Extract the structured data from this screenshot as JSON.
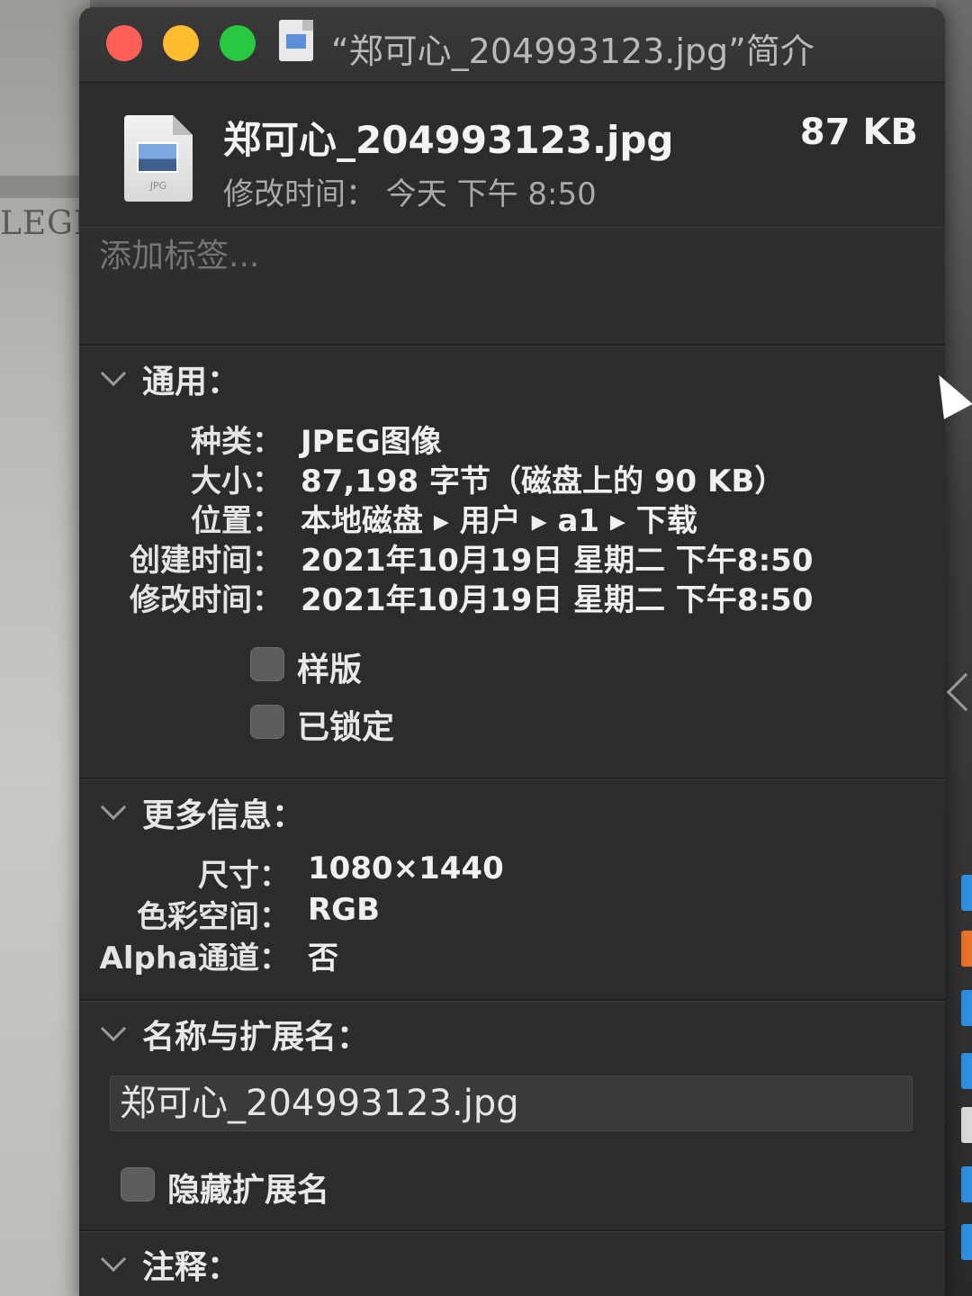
{
  "window": {
    "title": "“郑可心_204993123.jpg”简介"
  },
  "file": {
    "name": "郑可心_204993123.jpg",
    "size": "87 KB",
    "modified": "修改时间：  今天 下午 8:50",
    "icon_ext": "JPG"
  },
  "tags": {
    "placeholder": "添加标签..."
  },
  "general": {
    "title": "通用：",
    "rows": [
      {
        "key": "种类：",
        "value": "JPEG图像"
      },
      {
        "key": "大小：",
        "value": "87,198 字节（磁盘上的 90 KB）"
      },
      {
        "key": "位置：",
        "value": "本地磁盘 ▸ 用户 ▸ a1 ▸ 下载"
      },
      {
        "key": "创建时间：",
        "value": "2021年10月19日 星期二 下午8:50"
      },
      {
        "key": "修改时间：",
        "value": "2021年10月19日 星期二 下午8:50"
      }
    ],
    "stationery_label": "样版",
    "locked_label": "已锁定"
  },
  "more_info": {
    "title": "更多信息：",
    "rows": [
      {
        "key": "尺寸：",
        "value": "1080×1440"
      },
      {
        "key": "色彩空间：",
        "value": "RGB"
      },
      {
        "key": "Alpha通道：",
        "value": "否"
      }
    ]
  },
  "name_ext": {
    "title": "名称与扩展名：",
    "value": "郑可心_204993123.jpg",
    "hide_ext_label": "隐藏扩展名"
  },
  "comments": {
    "title": "注释："
  },
  "background": {
    "left_text": "LEGEI"
  },
  "colors": {
    "close": "#fe5f57",
    "minimize": "#febc2e",
    "maximize": "#28c840",
    "window_bg": "#2c2c2d"
  }
}
